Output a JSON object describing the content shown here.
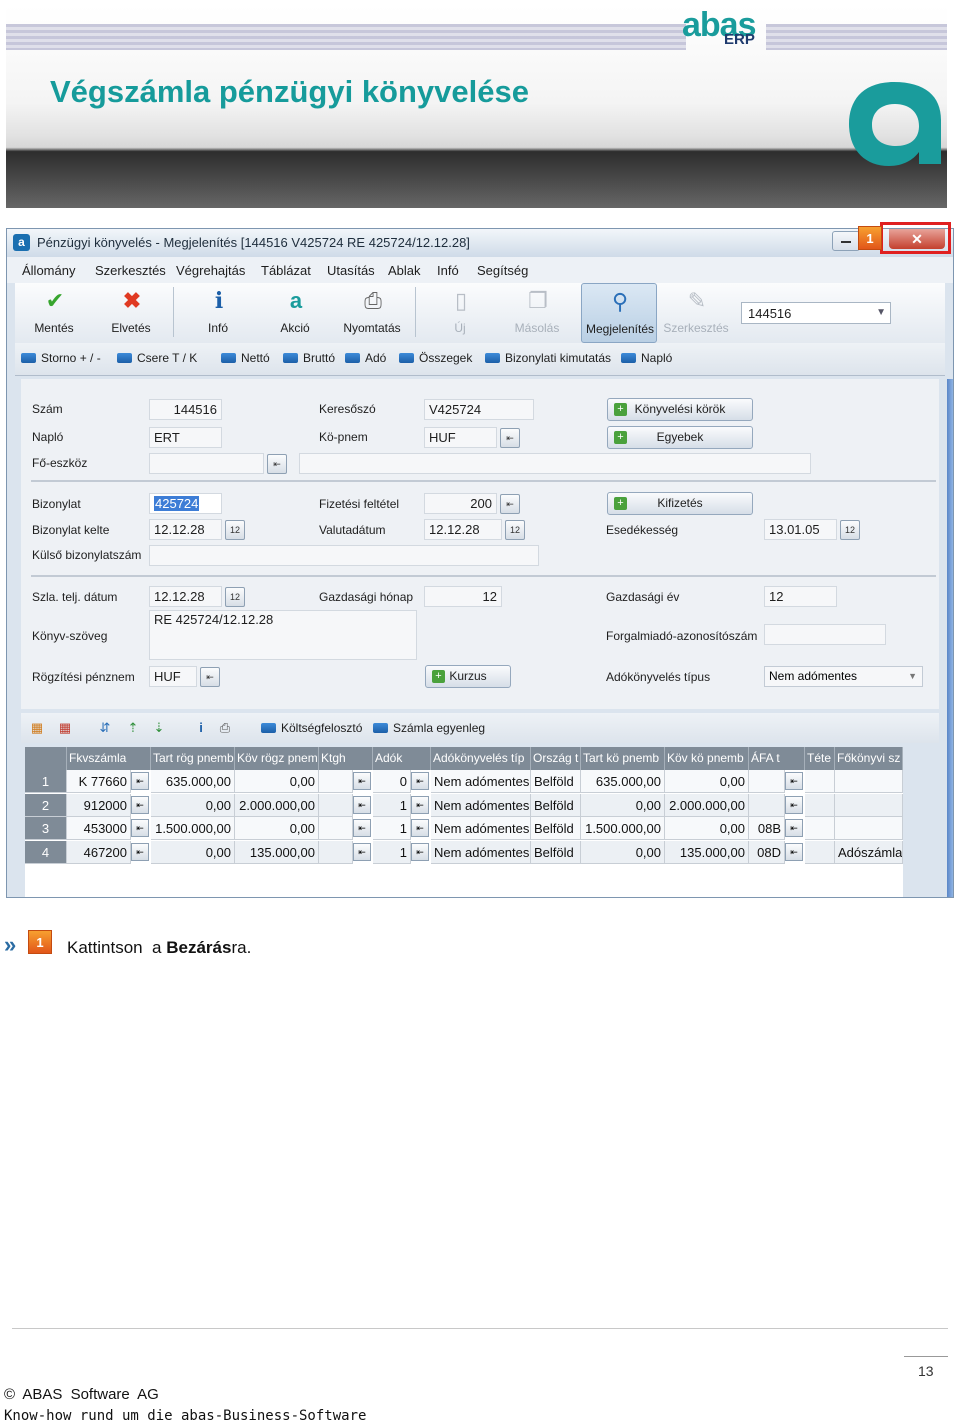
{
  "slide": {
    "title": "Végszámla pénzügyi könyvelése",
    "logo_text": "abas",
    "logo_sub": "ERP"
  },
  "window": {
    "title": "Pénzügyi könyvelés - Megjelenítés  [144516   V425724   RE 425724/12.12.28]",
    "close_label": "✕",
    "step_marker": "1",
    "menu": [
      "Állomány",
      "Szerkesztés",
      "Végrehajtás",
      "Táblázat",
      "Utasítás",
      "Ablak",
      "Infó",
      "Segítség"
    ],
    "toolbar": [
      {
        "label": "Mentés",
        "icon": "checkmark-icon"
      },
      {
        "label": "Elvetés",
        "icon": "cross-icon"
      },
      {
        "label": "Infó",
        "icon": "info-icon"
      },
      {
        "label": "Akció",
        "icon": "action-icon"
      },
      {
        "label": "Nyomtatás",
        "icon": "printer-icon"
      },
      {
        "label": "Új",
        "icon": "new-document-icon"
      },
      {
        "label": "Másolás",
        "icon": "copy-icon"
      },
      {
        "label": "Megjelenítés",
        "icon": "magnifier-icon"
      },
      {
        "label": "Szerkesztés",
        "icon": "edit-icon"
      }
    ],
    "toolbar_combo": "144516",
    "links": [
      "Storno + / -",
      "Csere  T / K",
      "Nettó",
      "Bruttó",
      "Adó",
      "Összegek",
      "Bizonylati kimutatás",
      "Napló"
    ],
    "form": {
      "szam_label": "Szám",
      "szam": "144516",
      "naplo_label": "Napló",
      "naplo": "ERT",
      "foeszkoz_label": "Fő-eszköz",
      "kereso_label": "Keresőszó",
      "kereso": "V425724",
      "kopnem_label": "Kö-pnem",
      "kopnem": "HUF",
      "konyvelesi_korok": "Könyvelési körök",
      "egyebek": "Egyebek",
      "bizonylat_label": "Bizonylat",
      "bizonylat": "425724",
      "bizonylat_kelte_label": "Bizonylat kelte",
      "bizonylat_kelte": "12.12.28",
      "kulso_label": "Külső bizonylatszám",
      "fizetesi_label": "Fizetési feltétel",
      "fizetesi": "200",
      "valutadatum_label": "Valutadátum",
      "valutadatum": "12.12.28",
      "kifizetes": "Kifizetés",
      "esedekesseg_label": "Esedékesség",
      "esedekesseg": "13.01.05",
      "szla_label": "Szla. telj. dátum",
      "szla": "12.12.28",
      "gazd_honap_label": "Gazdasági hónap",
      "gazd_honap": "12",
      "gazd_ev_label": "Gazdasági év",
      "gazd_ev": "12",
      "konyv_szoveg_label": "Könyv-szöveg",
      "konyv_szoveg": "RE 425724/12.12.28",
      "forgalmi_label": "Forgalmiadó-azonosítószám",
      "rogzitesi_label": "Rögzítési pénznem",
      "rogzitesi": "HUF",
      "kurzus": "Kurzus",
      "adokonyv_label": "Adókönyvelés típus",
      "adokonyv": "Nem adómentes",
      "pick_glyph": "⇤",
      "cal_glyph": "12"
    },
    "grid_toolbar_links": [
      "Költségfelosztó",
      "Számla egyenleg"
    ],
    "grid": {
      "headers": [
        "",
        "Fkvszámla",
        "Tart rög pnemb",
        "Köv rögz pnem",
        "Ktgh",
        "Adók",
        "Adókönyvelés típ",
        "Ország t",
        "Tart kö pnemb",
        "Köv kö pnemb",
        "ÁFA t",
        "Téte",
        "Főkönyvi sz"
      ],
      "rows": [
        {
          "n": "1",
          "acct": "K 77660",
          "tart": "635.000,00",
          "kov": "0,00",
          "ado": "0",
          "tip": "Nem adómentes",
          "orszag": "Belföld",
          "tartko": "635.000,00",
          "kovko": "0,00",
          "afa": "",
          "fok": ""
        },
        {
          "n": "2",
          "acct": "912000",
          "tart": "0,00",
          "kov": "2.000.000,00",
          "ado": "1",
          "tip": "Nem adómentes",
          "orszag": "Belföld",
          "tartko": "0,00",
          "kovko": "2.000.000,00",
          "afa": "",
          "fok": ""
        },
        {
          "n": "3",
          "acct": "453000",
          "tart": "1.500.000,00",
          "kov": "0,00",
          "ado": "1",
          "tip": "Nem adómentes",
          "orszag": "Belföld",
          "tartko": "1.500.000,00",
          "kovko": "0,00",
          "afa": "08B",
          "fok": ""
        },
        {
          "n": "4",
          "acct": "467200",
          "tart": "0,00",
          "kov": "135.000,00",
          "ado": "1",
          "tip": "Nem adómentes",
          "orszag": "Belföld",
          "tartko": "0,00",
          "kovko": "135.000,00",
          "afa": "08D",
          "fok": "Adószámla"
        }
      ]
    }
  },
  "instruction": {
    "chevron": "»",
    "marker": "1",
    "text_before": "Kattintson  a ",
    "text_bold": "Bezárás",
    "text_after": "ra."
  },
  "footer": {
    "page": "13",
    "copyright": "© ABAS Software AG",
    "tagline": "Know-how rund um die abas-Business-Software"
  },
  "colors": {
    "title": "#169b9b",
    "marker": "#ef7d22",
    "highlight": "#e02020"
  }
}
